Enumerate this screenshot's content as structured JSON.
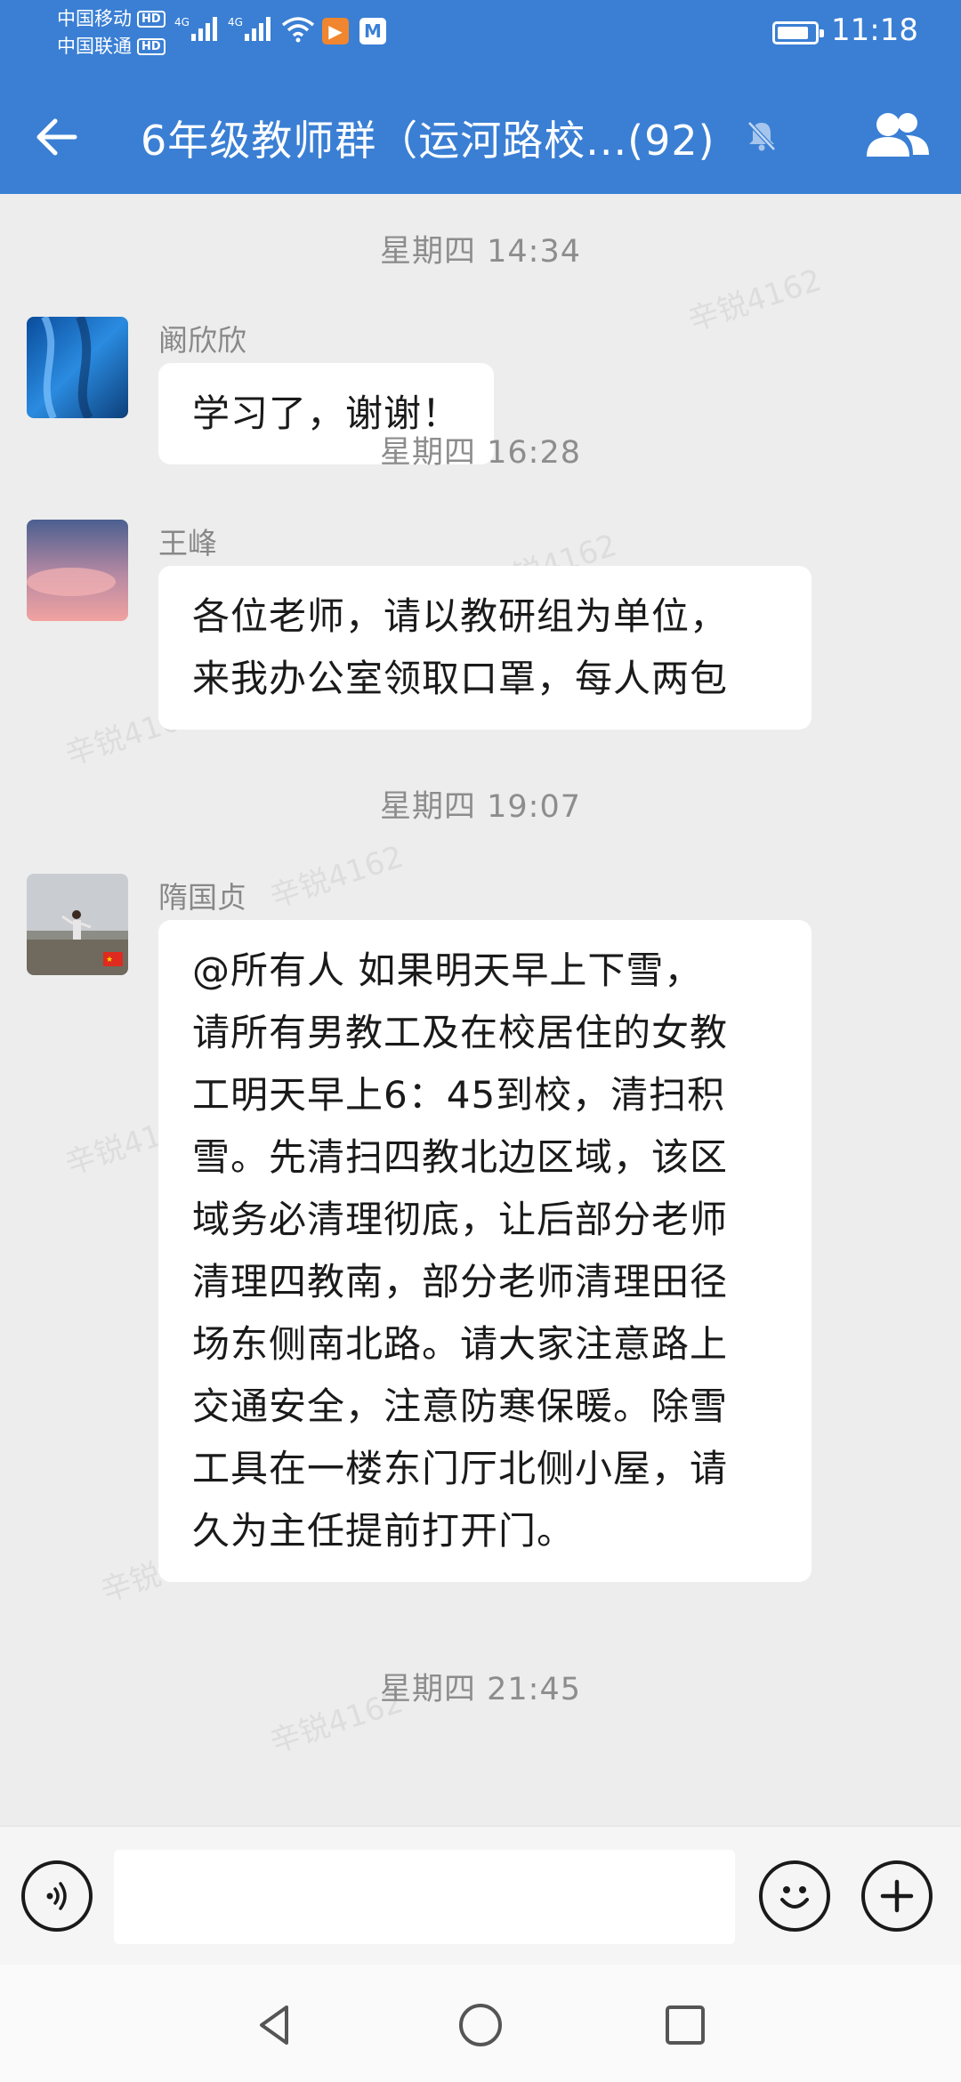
{
  "status_bar": {
    "carrier1": "中国移动",
    "carrier2": "中国联通",
    "hd_label": "HD",
    "network1": "4G",
    "network2": "4G",
    "time": "11:18"
  },
  "header": {
    "title": "6年级教师群（运河路校...(92)",
    "back_icon": "arrow-left-icon",
    "mute_icon": "bell-off-icon",
    "members_icon": "group-members-icon"
  },
  "messages": [
    {
      "timestamp": "星期四  14:34",
      "sender": "阚欣欣",
      "text": [
        "学习了，谢谢！"
      ]
    },
    {
      "timestamp": "星期四  16:28",
      "sender": "王峰",
      "text": [
        "各位老师，请以教研组为单位，",
        "来我办公室领取口罩，每人两包"
      ]
    },
    {
      "timestamp": "星期四  19:07",
      "sender": "隋国贞",
      "text": [
        "@所有人 如果明天早上下雪，",
        "请所有男教工及在校居住的女教",
        "工明天早上6：45到校，清扫积",
        "雪。先清扫四教北边区域，该区",
        "域务必清理彻底，让后部分老师",
        "清理四教南，部分老师清理田径",
        "场东侧南北路。请大家注意路上",
        "交通安全，注意防寒保暖。除雪",
        "工具在一楼东门厅北侧小屋，请",
        "久为主任提前打开门。"
      ]
    },
    {
      "timestamp": "星期四  21:45"
    }
  ],
  "watermark": "辛锐4162",
  "input_bar": {
    "placeholder": "",
    "voice_icon": "voice-icon",
    "emoji_icon": "emoji-icon",
    "plus_icon": "plus-icon"
  },
  "colors": {
    "header_bg": "#3a7fd4",
    "chat_bg": "#ededed",
    "bubble_bg": "#ffffff"
  }
}
